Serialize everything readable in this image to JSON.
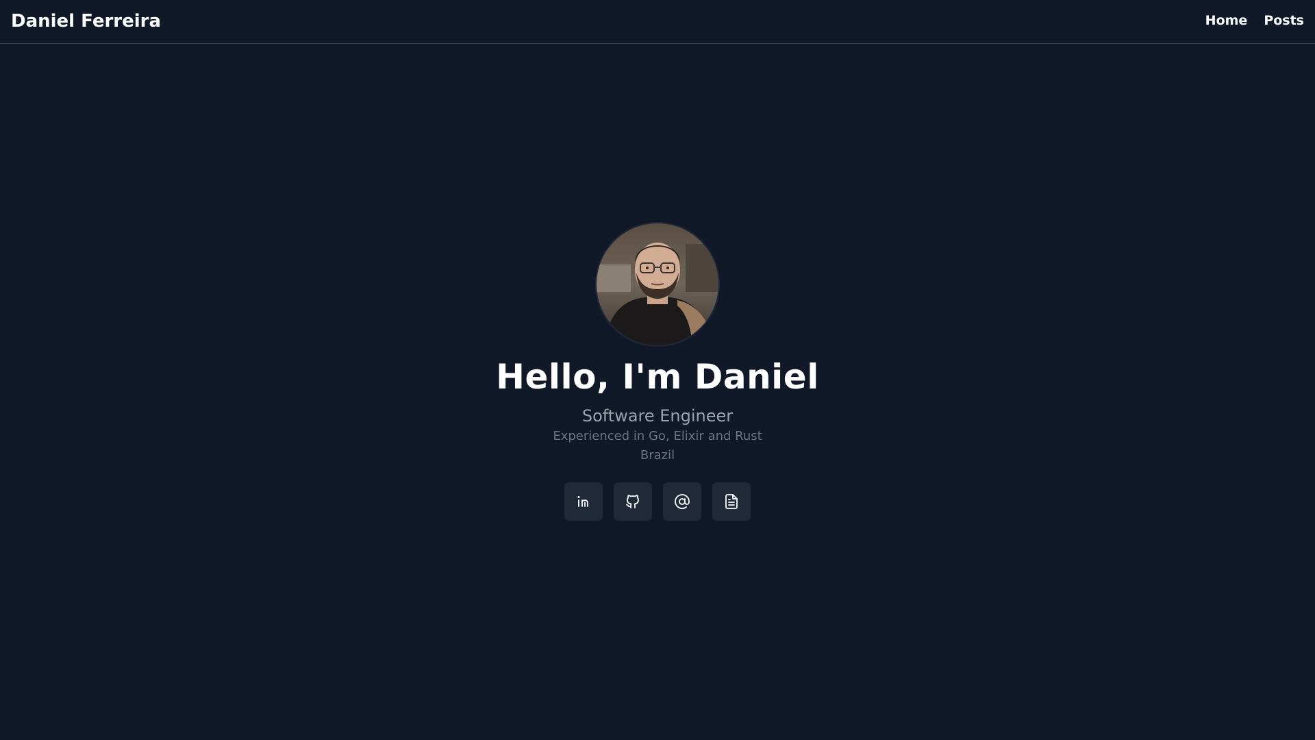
{
  "header": {
    "brand": "Daniel Ferreira",
    "nav": [
      {
        "label": "Home"
      },
      {
        "label": "Posts"
      }
    ]
  },
  "hero": {
    "avatar_alt": "profile photo",
    "title": "Hello, I'm Daniel",
    "subtitle": "Software Engineer",
    "description": "Experienced in Go, Elixir and Rust",
    "location": "Brazil"
  },
  "socials": [
    {
      "icon": "linkedin-icon"
    },
    {
      "icon": "github-icon"
    },
    {
      "icon": "email-at-icon"
    },
    {
      "icon": "document-icon"
    }
  ],
  "colors": {
    "background": "#111827",
    "button_bg": "#1f2937",
    "subtitle": "#9ca3af",
    "muted": "#6b7280",
    "border": "#374151"
  }
}
